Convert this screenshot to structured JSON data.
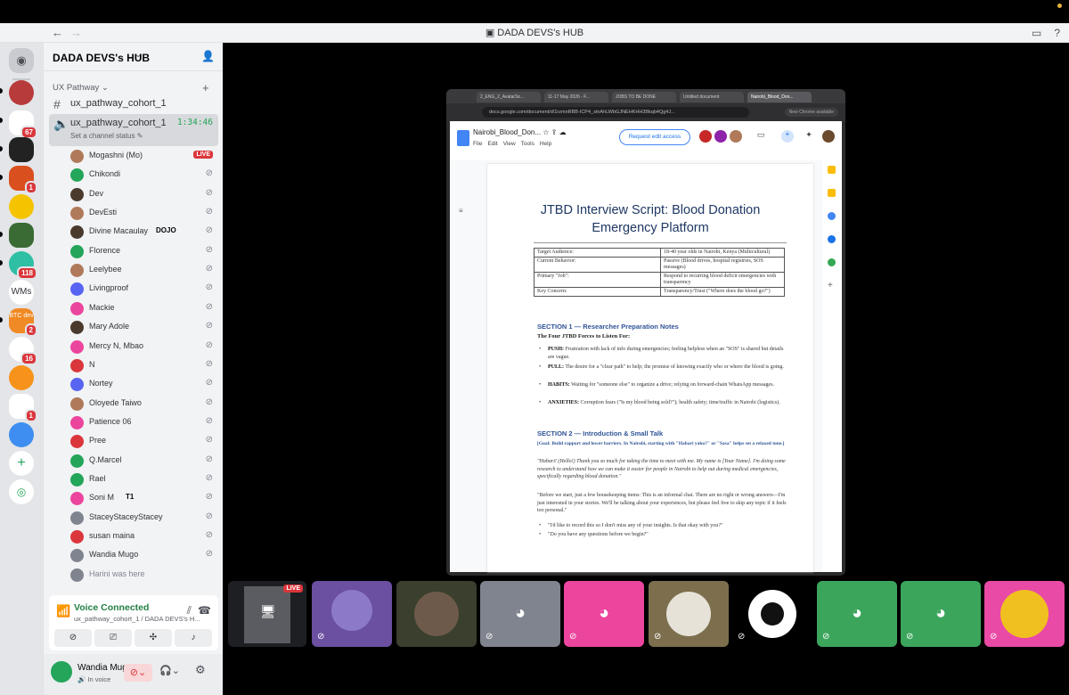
{
  "window": {
    "title": "DADA DEVS's HUB",
    "back": "←",
    "forward": "→"
  },
  "rail": {
    "servers": [
      {
        "badge": ""
      },
      {
        "badge": "67"
      },
      {
        "badge": ""
      },
      {
        "badge": "1"
      },
      {
        "badge": ""
      },
      {
        "badge": ""
      },
      {
        "badge": "118"
      },
      {
        "label": "WMs",
        "badge": ""
      },
      {
        "label": "BTC dev",
        "badge": "2"
      },
      {
        "badge": "16"
      },
      {
        "badge": ""
      },
      {
        "badge": "1"
      },
      {
        "badge": ""
      }
    ]
  },
  "guild": {
    "name": "DADA DEVS's HUB"
  },
  "category": {
    "name": "UX Pathway"
  },
  "channels": {
    "text": {
      "name": "ux_pathway_cohort_1"
    },
    "voice": {
      "name": "ux_pathway_cohort_1",
      "timer": "1:34:46",
      "status": "Set a channel status"
    }
  },
  "users": [
    {
      "name": "Mogashni (Mo)",
      "live": "LIVE"
    },
    {
      "name": "Chikondi"
    },
    {
      "name": "Dev"
    },
    {
      "name": "DevEsti"
    },
    {
      "name": "Divine Macaulay",
      "tag": "DOJO"
    },
    {
      "name": "Florence"
    },
    {
      "name": "Leelybee"
    },
    {
      "name": "Livingproof"
    },
    {
      "name": "Mackie"
    },
    {
      "name": "Mary Adole"
    },
    {
      "name": "Mercy N, Mbao"
    },
    {
      "name": "N"
    },
    {
      "name": "Nortey"
    },
    {
      "name": "Oloyede Taiwo"
    },
    {
      "name": "Patience 06"
    },
    {
      "name": "Pree"
    },
    {
      "name": "Q.Marcel"
    },
    {
      "name": "Rael"
    },
    {
      "name": "Soni M",
      "tag": "T1"
    },
    {
      "name": "StaceyStaceyStacey"
    },
    {
      "name": "susan maina"
    },
    {
      "name": "Wandia Mugo"
    },
    {
      "name": "Harini was here"
    }
  ],
  "voice_panel": {
    "status": "Voice Connected",
    "location": "ux_pathway_cohort_1 / DADA DEVS's H..."
  },
  "user_panel": {
    "name": "Wandia Mugo",
    "status": "In voice"
  },
  "browser": {
    "tabs": [
      "2_ENG_2_AvatarSo...",
      "11-17 May 2026 - F...",
      "JOBS TO BE DONE",
      "Untitled document",
      "Nairobi_Blood_Don..."
    ],
    "url": "docs.google.com/document/d/1rzmnRBB-ICP4_stnAhLWbGJNEHKHH3Bkqb4Qg4J...",
    "new_version": "New Chrome available"
  },
  "doc": {
    "name": "Nairobi_Blood_Don...",
    "menu": [
      "File",
      "Edit",
      "View",
      "Tools",
      "Help"
    ],
    "request_edit": "Request edit access",
    "title_line1": "JTBD Interview Script: Blood Donation",
    "title_line2": "Emergency Platform",
    "table": [
      [
        "Target Audience:",
        "18-40 year olds in Nairobi, Kenya (Multicultural)"
      ],
      [
        "Current Behavior:",
        "Passive (Blood drives, hospital registries, SOS messages)"
      ],
      [
        "Primary \"Job\":",
        "Respond to recurring blood deficit emergencies with transparency"
      ],
      [
        "Key Concern:",
        "Transparency/Trust (\"Where does the blood go?\")"
      ]
    ],
    "section1": "SECTION 1 — Researcher Preparation Notes",
    "forces_title": "The Four JTBD Forces to Listen For:",
    "forces": [
      {
        "k": "PUSH:",
        "v": "Frustration with lack of info during emergencies; feeling helpless when an \"SOS\" is shared but details are vague."
      },
      {
        "k": "PULL:",
        "v": "The desire for a \"clear path\" to help; the promise of knowing exactly who or where the blood is going."
      },
      {
        "k": "HABITS:",
        "v": "Waiting for \"someone else\" to organize a drive; relying on forward-chain WhatsApp messages."
      },
      {
        "k": "ANXIETIES:",
        "v": "Corruption fears (\"Is my blood being sold?\"); health safety; time/traffic in Nairobi (logistics)."
      }
    ],
    "section2": "SECTION 2 — Introduction & Small Talk",
    "goal": "[Goal: Build rapport and lower barriers. In Nairobi, starting with \"Habari yako?\" or \"Sasa\" helps set a relaxed tone.]",
    "intro": "\"Habari! (Hello!) Thank you so much for taking the time to meet with me. My name is [Your Name]. I'm doing some research to understand how we can make it easier for people in Nairobi to help out during medical emergencies, specifically regarding blood donation.\"",
    "housekeeping": "\"Before we start, just a few housekeeping items: This is an informal chat. There are no right or wrong answers—I'm just interested in your stories. We'll be talking about your experiences, but please feel free to skip any topic if it feels too personal.\"",
    "q1": "\"I'd like to record this so I don't miss any of your insights. Is that okay with you?\"",
    "q2": "\"Do you have any questions before we begin?\""
  },
  "tiles": {
    "live_label": "LIVE"
  },
  "colors": {
    "accent": "#5865f2",
    "green": "#23a55a",
    "pink": "#eb459e",
    "red": "#da373c",
    "doc_heading": "#1f3864",
    "doc_section": "#2f5496"
  }
}
